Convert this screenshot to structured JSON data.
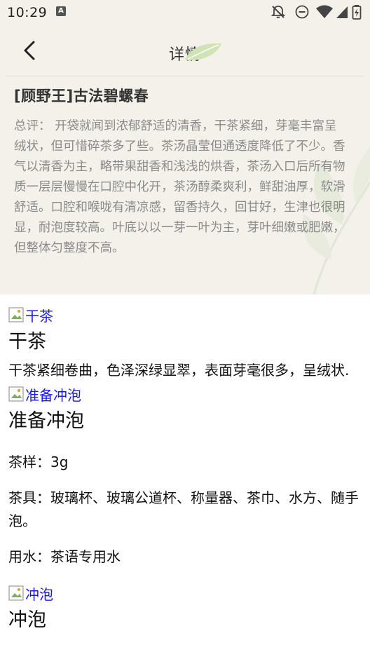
{
  "status_bar": {
    "time": "10:29",
    "notification_badge": "A"
  },
  "nav": {
    "title": "详情"
  },
  "tea": {
    "name": "[顾野王]古法碧螺春",
    "summary": "总评： 开袋就闻到浓郁舒适的清香，干茶紧细，芽毫丰富呈绒状，但可惜碎茶多了些。茶汤晶莹但通透度降低了不少。香气以清香为主，略带果甜香和浅浅的烘香，茶汤入口后所有物质一层层慢慢在口腔中化开，茶汤醇柔爽利，鲜甜油厚，软滑舒适。口腔和喉咙有清凉感，留香持久，回甘好，生津也很明显，耐泡度较高。叶底以以一芽一叶为主，芽叶细嫩或肥嫩，但整体匀整度不高。"
  },
  "sections": {
    "dry_tea": {
      "image_alt": "干茶",
      "title": "干茶",
      "text": "干茶紧细卷曲，色泽深绿显翠，表面芽毫很多，呈绒状."
    },
    "prepare": {
      "image_alt": "准备冲泡",
      "title": "准备冲泡",
      "sample": "茶样：3g",
      "utensils": "茶具：玻璃杯、玻璃公道杯、称量器、茶巾、水方、随手泡。",
      "water": "用水：茶语专用水"
    },
    "brew": {
      "image_alt": "冲泡",
      "title": "冲泡"
    }
  },
  "colors": {
    "background_top": "#f3f1ea",
    "summary_text": "#8b8b8b",
    "link_alt": "#1a1aee",
    "leaf_green": "#cfe3b4"
  }
}
